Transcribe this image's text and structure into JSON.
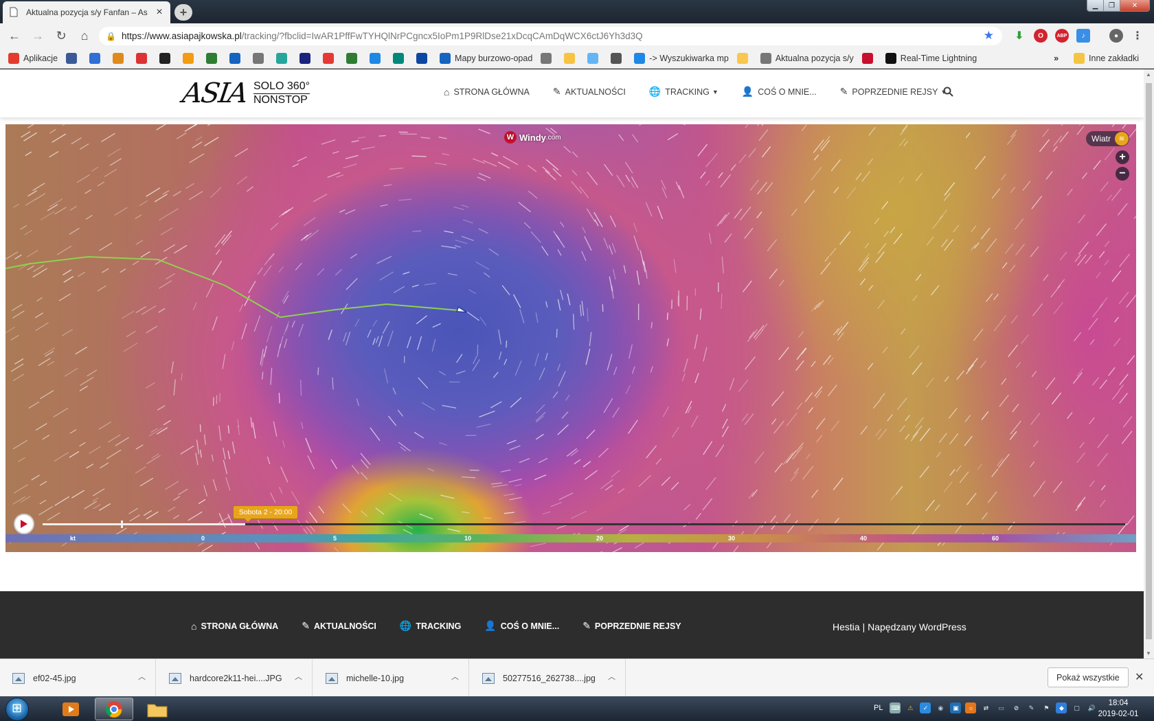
{
  "browser": {
    "tab_title": "Aktualna pozycja s/y Fanfan – As",
    "url_host": "https://www.asiapajkowska.pl",
    "url_path": "/tracking/?fbclid=IwAR1PffFwTYHQlNrPCgncx5IoPm1P9RlDse21xDcqCAmDqWCX6ctJ6Yh3d3Q",
    "bookmarks": [
      {
        "label": "Aplikacje",
        "icon": "apps-grid-icon",
        "color": "#e33b2e"
      },
      {
        "label": "",
        "icon": "facebook-icon",
        "color": "#3b5998"
      },
      {
        "label": "",
        "icon": "at-sign-icon",
        "color": "#2f6fd6"
      },
      {
        "label": "",
        "icon": "sun-icon",
        "color": "#e08a1e"
      },
      {
        "label": "",
        "icon": "cloud-icon",
        "color": "#d33"
      },
      {
        "label": "",
        "icon": "b-icon",
        "color": "#222"
      },
      {
        "label": "",
        "icon": "amazon-icon",
        "color": "#f39c12"
      },
      {
        "label": "",
        "icon": "chat-icon",
        "color": "#2e7d32"
      },
      {
        "label": "",
        "icon": "bars-icon",
        "color": "#1565c0"
      },
      {
        "label": "",
        "icon": "page-icon",
        "color": "#777"
      },
      {
        "label": "",
        "icon": "app-icon",
        "color": "#26a69a"
      },
      {
        "label": "",
        "icon": "dba-icon",
        "color": "#1a237e"
      },
      {
        "label": "",
        "icon": "b-circle-icon",
        "color": "#e53935"
      },
      {
        "label": "",
        "icon": "mi-icon",
        "color": "#2e7d32"
      },
      {
        "label": "",
        "icon": "sail-icon",
        "color": "#1e88e5"
      },
      {
        "label": "",
        "icon": "globe-icon",
        "color": "#00897b"
      },
      {
        "label": "",
        "icon": "drop-icon",
        "color": "#0d47a1"
      },
      {
        "label": "Mapy burzowo-opad",
        "icon": "plane-icon",
        "color": "#1565c0"
      },
      {
        "label": "",
        "icon": "page-icon",
        "color": "#777"
      },
      {
        "label": "",
        "icon": "coin-icon",
        "color": "#f6c343"
      },
      {
        "label": "",
        "icon": "dash-icon",
        "color": "#64b5f6"
      },
      {
        "label": "",
        "icon": "dots-icon",
        "color": "#555"
      },
      {
        "label": "-> Wyszukiwarka mp",
        "icon": "heart-icon",
        "color": "#1e88e5"
      },
      {
        "label": "",
        "icon": "sun-icon",
        "color": "#f9c74f"
      },
      {
        "label": "Aktualna pozycja s/y",
        "icon": "page-icon",
        "color": "#777"
      },
      {
        "label": "",
        "icon": "windy-icon",
        "color": "#c8102e"
      },
      {
        "label": "Real-Time Lightning",
        "icon": "lightning-icon",
        "color": "#111"
      }
    ],
    "more_bookmarks": "»",
    "other_bookmarks": "Inne zakładki"
  },
  "site": {
    "logo_main": "ASIA",
    "logo_line1": "SOLO 360°",
    "logo_line2": "NONSTOP",
    "nav": [
      {
        "label": "STRONA GŁÓWNA",
        "icon": "home-icon",
        "dropdown": false
      },
      {
        "label": "AKTUALNOŚCI",
        "icon": "edit-icon",
        "dropdown": false
      },
      {
        "label": "TRACKING",
        "icon": "globe-icon",
        "dropdown": true
      },
      {
        "label": "COŚ O MNIE...",
        "icon": "user-icon",
        "dropdown": false
      },
      {
        "label": "POPRZEDNIE REJSY",
        "icon": "edit-icon",
        "dropdown": true
      }
    ]
  },
  "map": {
    "brand": "Windy",
    "brand_suffix": ".com",
    "layer_label": "Wiatr",
    "zoom_in": "+",
    "zoom_out": "−",
    "time_label": "Sobota 2 - 20:00",
    "timeline_progress": 0.187,
    "legend_unit": "kt",
    "legend_values": [
      "0",
      "5",
      "10",
      "20",
      "30",
      "40",
      "60"
    ],
    "track_color": "#8fd14f"
  },
  "footer": {
    "nav": [
      {
        "label": "STRONA GŁÓWNA",
        "icon": "home-icon"
      },
      {
        "label": "AKTUALNOŚCI",
        "icon": "edit-icon"
      },
      {
        "label": "TRACKING",
        "icon": "globe-icon"
      },
      {
        "label": "COŚ O MNIE...",
        "icon": "user-icon"
      },
      {
        "label": "POPRZEDNIE REJSY",
        "icon": "edit-icon"
      }
    ],
    "credits_a": "Hestia",
    "credits_sep": " | ",
    "credits_b": "Napędzany WordPress"
  },
  "downloads": {
    "items": [
      "ef02-45.jpg",
      "hardcore2k11-hei....JPG",
      "michelle-10.jpg",
      "50277516_262738....jpg"
    ],
    "show_all": "Pokaż wszystkie"
  },
  "taskbar": {
    "lang": "PL",
    "time": "18:04",
    "date": "2019-02-01"
  }
}
